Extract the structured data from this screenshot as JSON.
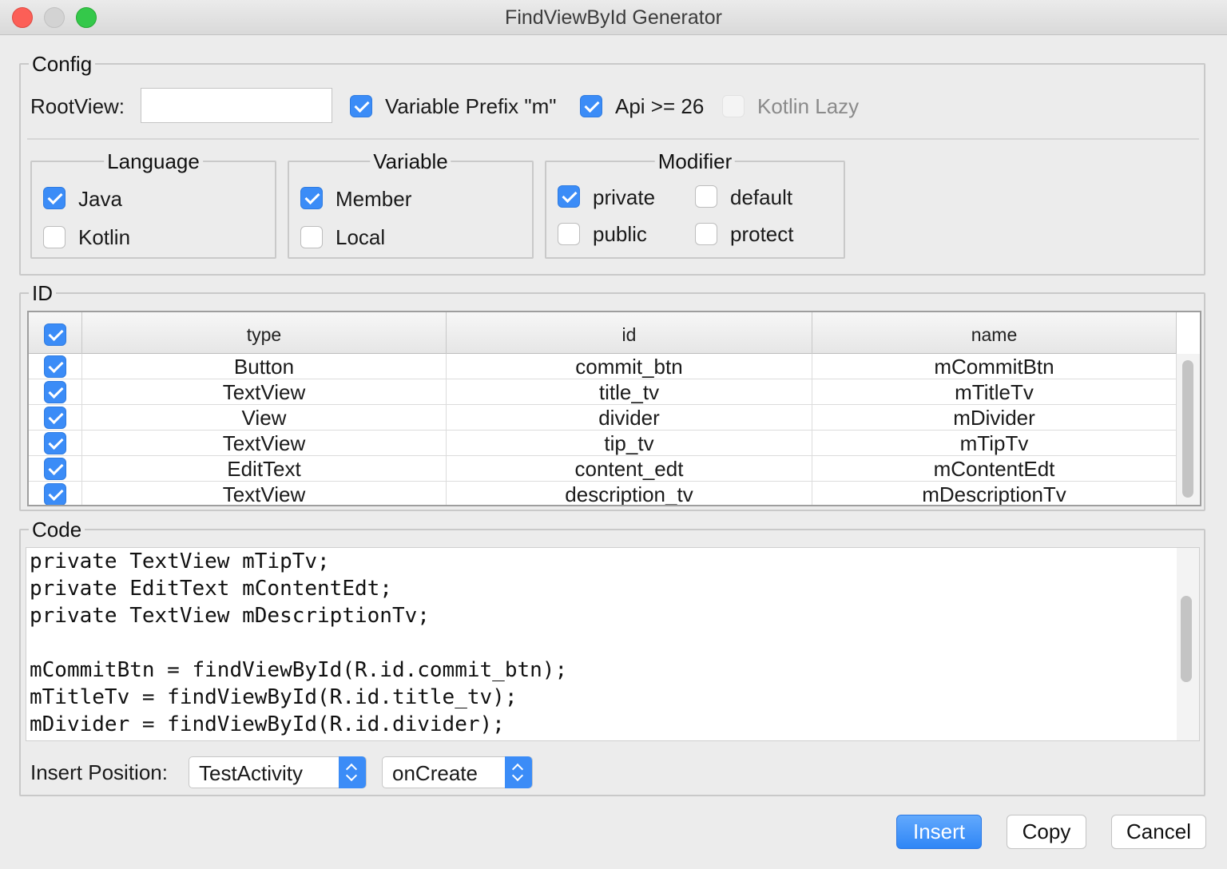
{
  "window": {
    "title": "FindViewById Generator"
  },
  "config": {
    "title": "Config",
    "root_view_label": "RootView:",
    "root_view_value": "",
    "variable_prefix": {
      "label": "Variable Prefix \"m\"",
      "checked": true
    },
    "api26": {
      "label": "Api >= 26",
      "checked": true
    },
    "kotlin_lazy": {
      "label": "Kotlin Lazy",
      "checked": false,
      "disabled": true
    },
    "language": {
      "title": "Language",
      "java": "Java",
      "kotlin": "Kotlin",
      "selected": "Java"
    },
    "variable": {
      "title": "Variable",
      "member": "Member",
      "local": "Local",
      "selected": "Member"
    },
    "modifier": {
      "title": "Modifier",
      "private": "private",
      "default": "default",
      "public": "public",
      "protect": "protect",
      "selected": "private"
    }
  },
  "id_table": {
    "title": "ID",
    "columns": [
      "type",
      "id",
      "name"
    ],
    "rows": [
      {
        "checked": true,
        "type": "Button",
        "id": "commit_btn",
        "name": "mCommitBtn"
      },
      {
        "checked": true,
        "type": "TextView",
        "id": "title_tv",
        "name": "mTitleTv"
      },
      {
        "checked": true,
        "type": "View",
        "id": "divider",
        "name": "mDivider"
      },
      {
        "checked": true,
        "type": "TextView",
        "id": "tip_tv",
        "name": "mTipTv"
      },
      {
        "checked": true,
        "type": "EditText",
        "id": "content_edt",
        "name": "mContentEdt"
      },
      {
        "checked": true,
        "type": "TextView",
        "id": "description_tv",
        "name": "mDescriptionTv"
      }
    ]
  },
  "code": {
    "title": "Code",
    "lines": [
      "private TextView mTipTv;",
      "private EditText mContentEdt;",
      "private TextView mDescriptionTv;",
      "",
      "mCommitBtn = findViewById(R.id.commit_btn);",
      "mTitleTv = findViewById(R.id.title_tv);",
      "mDivider = findViewById(R.id.divider);"
    ],
    "insert_position_label": "Insert Position:",
    "class_select": "TestActivity",
    "method_select": "onCreate"
  },
  "buttons": {
    "insert": "Insert",
    "copy": "Copy",
    "cancel": "Cancel"
  },
  "colors": {
    "accent": "#3b8cf7",
    "close": "#fc5f57",
    "maximize": "#34c84a"
  }
}
